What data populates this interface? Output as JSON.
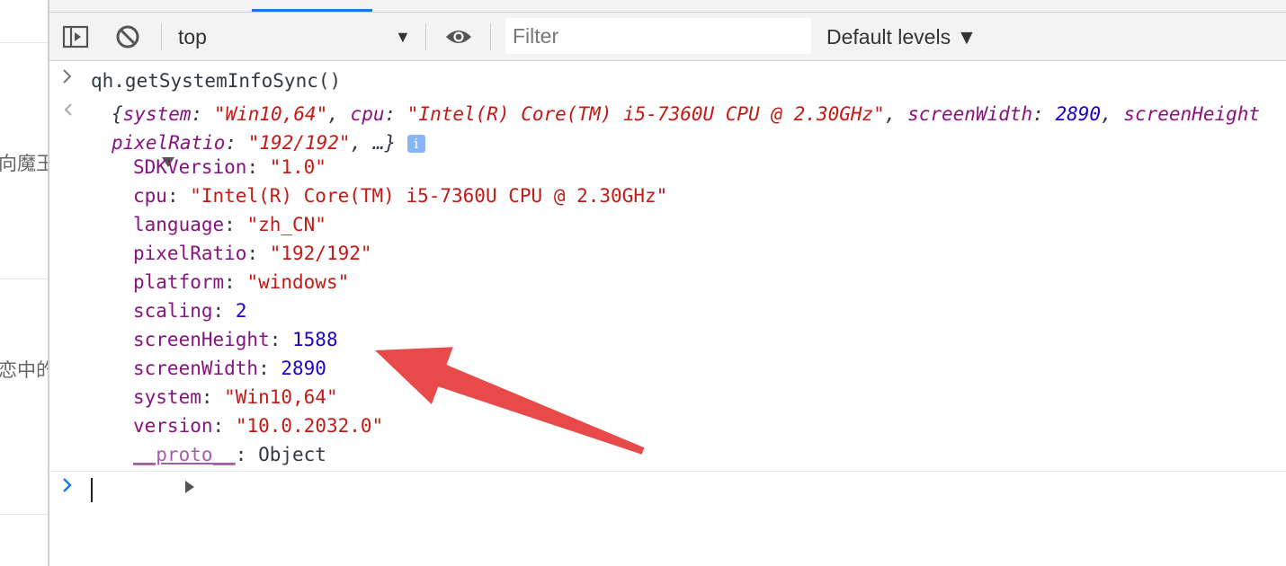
{
  "left_page": {
    "snippet_1": "向魔王",
    "snippet_2": "恋中的"
  },
  "toolbar": {
    "sidebar_icon": "sidebar-toggle-icon",
    "clear_icon": "block-icon",
    "context": "top",
    "eye_icon": "eye-icon",
    "filter_placeholder": "Filter",
    "levels": "Default levels ▼"
  },
  "console": {
    "input_command": "qh.getSystemInfoSync()",
    "summary": {
      "open": "{",
      "k1": "system",
      "v1": "\"Win10,64\"",
      "k2": "cpu",
      "v2": "\"Intel(R) Core(TM) i5-7360U CPU @ 2.30GHz\"",
      "k3": "screenWidth",
      "v3": "2890",
      "k4": "screenHeight",
      "k5": "pixelRatio",
      "v5": "\"192/192\"",
      "tail": ", …}",
      "info": "i"
    },
    "properties": [
      {
        "key": "SDKVersion",
        "value": "\"1.0\"",
        "type": "string"
      },
      {
        "key": "cpu",
        "value": "\"Intel(R) Core(TM) i5-7360U CPU @ 2.30GHz\"",
        "type": "string"
      },
      {
        "key": "language",
        "value": "\"zh_CN\"",
        "type": "string"
      },
      {
        "key": "pixelRatio",
        "value": "\"192/192\"",
        "type": "string"
      },
      {
        "key": "platform",
        "value": "\"windows\"",
        "type": "string"
      },
      {
        "key": "scaling",
        "value": "2",
        "type": "number"
      },
      {
        "key": "screenHeight",
        "value": "1588",
        "type": "number"
      },
      {
        "key": "screenWidth",
        "value": "2890",
        "type": "number"
      },
      {
        "key": "system",
        "value": "\"Win10,64\"",
        "type": "string"
      },
      {
        "key": "version",
        "value": "\"10.0.2032.0\"",
        "type": "string"
      }
    ],
    "proto_key": "__proto__",
    "proto_value": "Object"
  },
  "colors": {
    "key": "#881280",
    "string": "#c41a16",
    "number": "#1c00cf",
    "annotation_arrow": "#e84a4a",
    "accent_tab": "#1a73e8"
  }
}
